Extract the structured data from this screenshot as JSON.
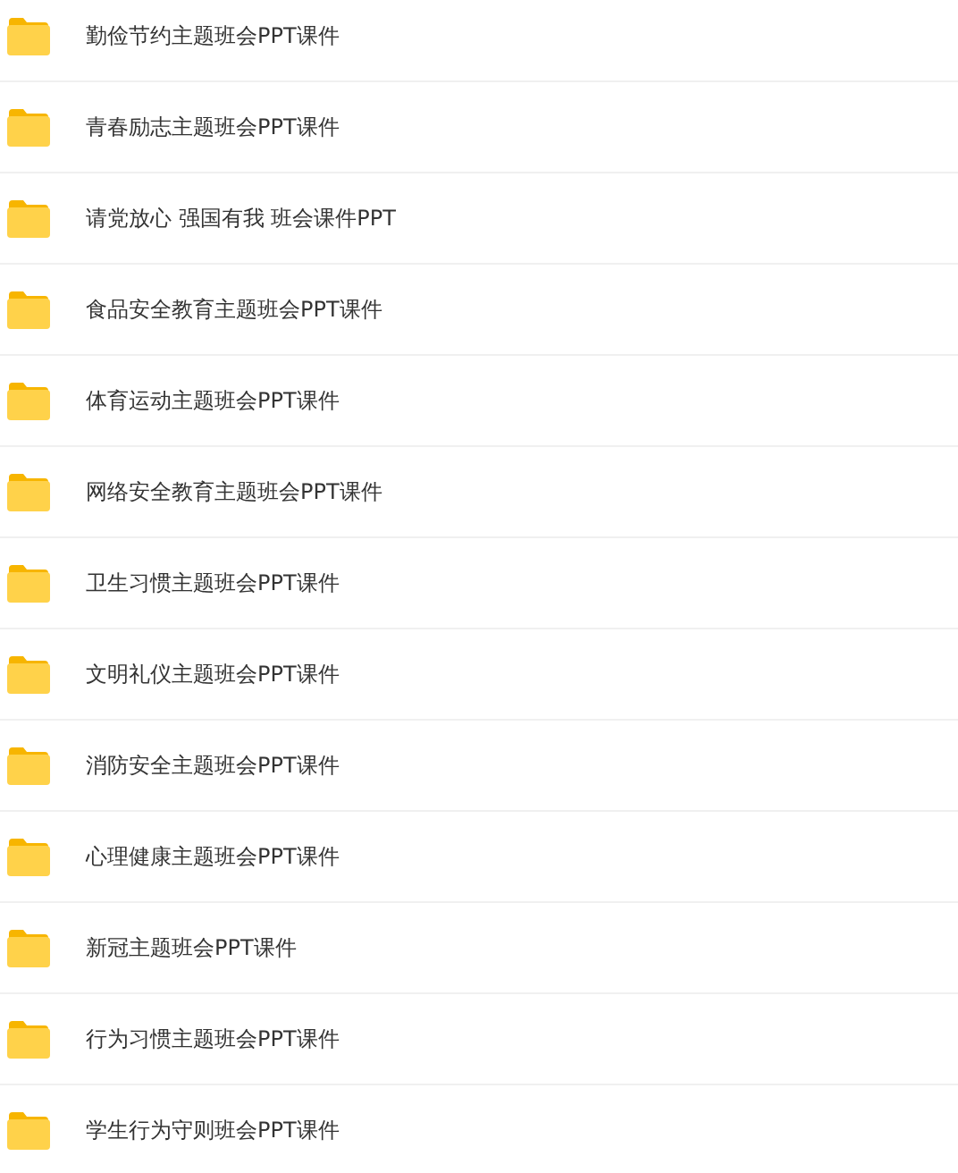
{
  "folders": [
    {
      "name": "勤俭节约主题班会PPT课件"
    },
    {
      "name": "青春励志主题班会PPT课件"
    },
    {
      "name": "请党放心 强国有我 班会课件PPT"
    },
    {
      "name": "食品安全教育主题班会PPT课件"
    },
    {
      "name": "体育运动主题班会PPT课件"
    },
    {
      "name": "网络安全教育主题班会PPT课件"
    },
    {
      "name": "卫生习惯主题班会PPT课件"
    },
    {
      "name": "文明礼仪主题班会PPT课件"
    },
    {
      "name": "消防安全主题班会PPT课件"
    },
    {
      "name": "心理健康主题班会PPT课件"
    },
    {
      "name": "新冠主题班会PPT课件"
    },
    {
      "name": "行为习惯主题班会PPT课件"
    },
    {
      "name": "学生行为守则班会PPT课件"
    }
  ]
}
